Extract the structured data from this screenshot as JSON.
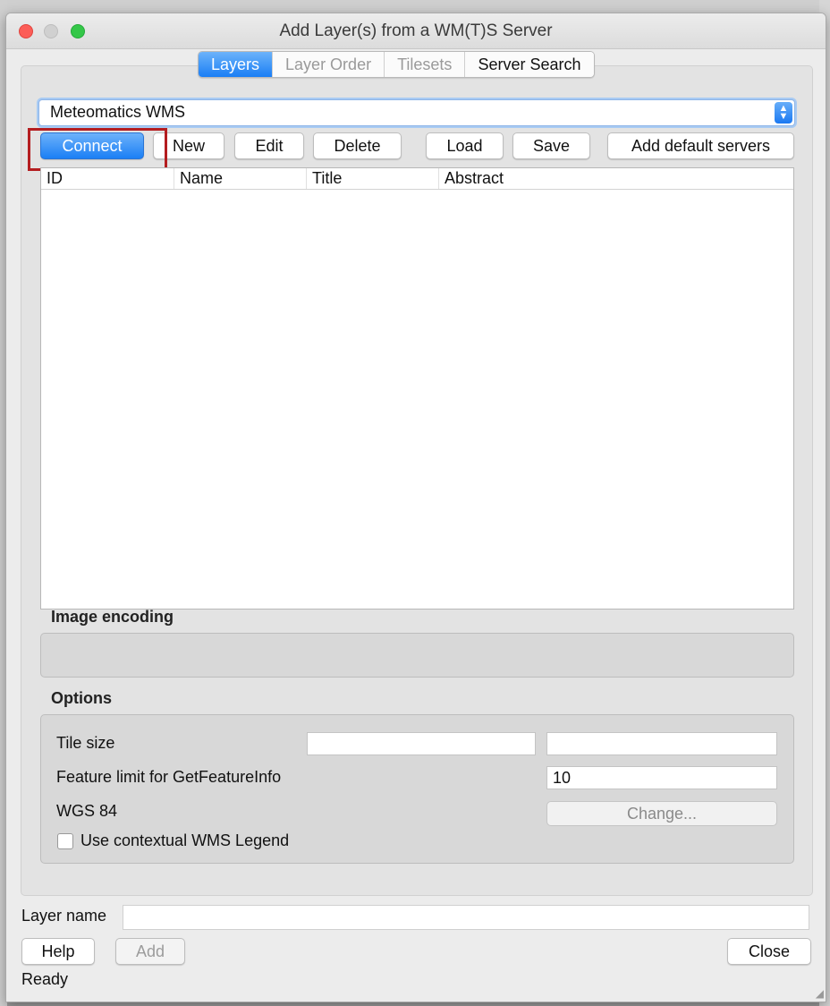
{
  "window": {
    "title": "Add Layer(s) from a WM(T)S Server"
  },
  "tabs": [
    {
      "label": "Layers",
      "active": true
    },
    {
      "label": "Layer Order",
      "active": false
    },
    {
      "label": "Tilesets",
      "active": false
    },
    {
      "label": "Server Search",
      "active": false
    }
  ],
  "server_select": {
    "value": "Meteomatics WMS"
  },
  "connection_buttons": {
    "connect": "Connect",
    "new": "New",
    "edit": "Edit",
    "delete": "Delete",
    "load": "Load",
    "save": "Save",
    "add_default": "Add default servers"
  },
  "layers_table": {
    "columns": [
      "ID",
      "Name",
      "Title",
      "Abstract"
    ],
    "rows": []
  },
  "image_encoding": {
    "label": "Image encoding"
  },
  "options": {
    "label": "Options",
    "tile_size_label": "Tile size",
    "tile_width": "",
    "tile_height": "",
    "feature_limit_label": "Feature limit for GetFeatureInfo",
    "feature_limit_value": "10",
    "crs_label": "WGS 84",
    "change_button": "Change...",
    "contextual_legend_label": "Use contextual WMS Legend",
    "contextual_legend_checked": false
  },
  "layer_name": {
    "label": "Layer name",
    "value": ""
  },
  "footer": {
    "help": "Help",
    "add": "Add",
    "close": "Close",
    "status": "Ready"
  },
  "colors": {
    "accent": "#1b7ff5",
    "highlight_box": "#b41d20",
    "close_traffic": "#fc5d57",
    "max_traffic": "#34c748"
  }
}
